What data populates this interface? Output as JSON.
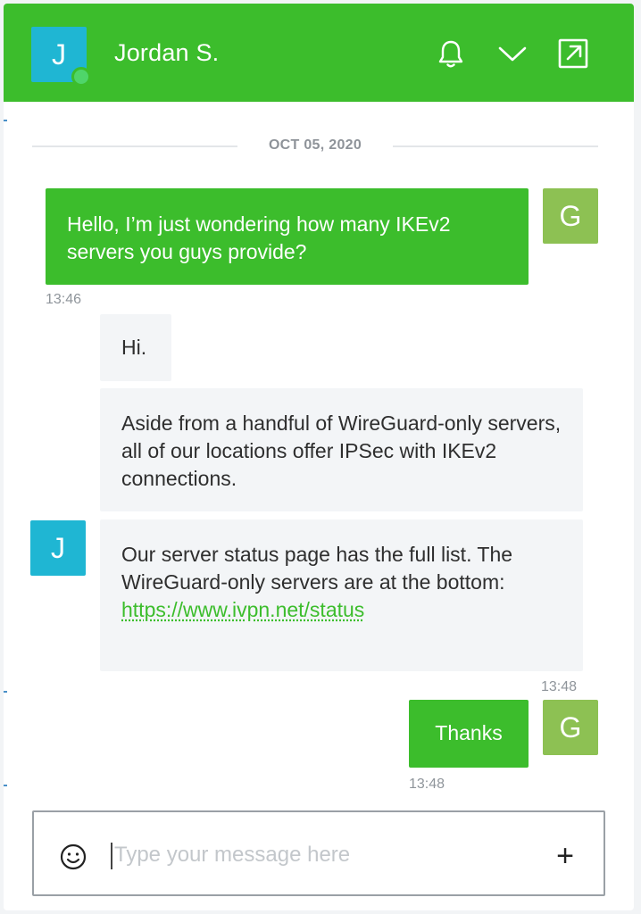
{
  "header": {
    "agent_initial": "J",
    "agent_name": "Jordan S.",
    "icons": [
      "bell-icon",
      "chevron-down-icon",
      "popout-icon"
    ],
    "brand_color": "#3cbd2c"
  },
  "conversation": {
    "date_divider": "OCT 05, 2020",
    "user_initial": "G",
    "agent_initial": "J",
    "messages": [
      {
        "text": "Hello, I’m just wondering how many IKEv2 servers you guys provide?",
        "time": "13:46"
      },
      {
        "text": "Hi."
      },
      {
        "text": "Aside from a handful of WireGuard-only servers, all of our locations offer IPSec with IKEv2 connections."
      },
      {
        "text": "Our server status page has the full list. The WireGuard-only servers are at the bottom:",
        "link": "https://www.ivpn.net/status",
        "time": "13:48"
      },
      {
        "text": "Thanks",
        "time": "13:48"
      }
    ]
  },
  "composer": {
    "placeholder": "Type your message here",
    "value": "",
    "icons": [
      "smiley-icon",
      "plus-icon"
    ]
  }
}
